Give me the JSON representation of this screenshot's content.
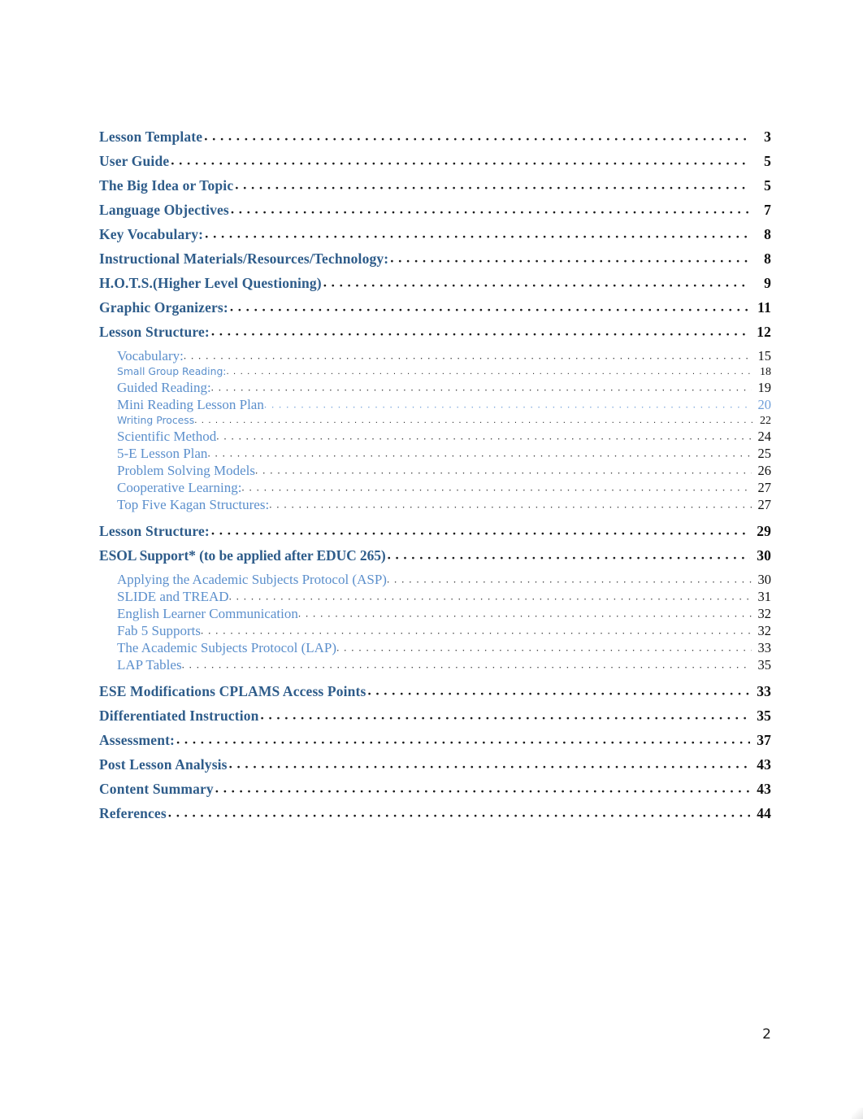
{
  "document": {
    "footer_page_number": "2",
    "colors": {
      "heading_blue": "#2e5c8a",
      "subheading_blue": "#5b8fcc",
      "leader_dark": "#2b2b2b",
      "leader_blue": "#6f9ed8",
      "page_number_dark": "#0d0d0d"
    }
  },
  "toc": {
    "entries": [
      {
        "level": 1,
        "label": "Lesson  Template",
        "page": "3"
      },
      {
        "level": 1,
        "label": "User Guide",
        "page": "5"
      },
      {
        "level": 1,
        "label": "The Big Idea or Topic",
        "page": "5"
      },
      {
        "level": 1,
        "label": "Language Objectives",
        "page": "7"
      },
      {
        "level": 1,
        "label": "Key  Vocabulary:",
        "page": "8"
      },
      {
        "level": 1,
        "label": "Instructional  Materials/Resources/Technology:",
        "page": "8"
      },
      {
        "level": 1,
        "label": "H.O.T.S.(Higher Level Questioning)",
        "page": "9"
      },
      {
        "level": 1,
        "label": "Graphic  Organizers:",
        "page": "11"
      },
      {
        "level": 1,
        "label": "Lesson  Structure:",
        "page": "12"
      },
      {
        "level": 2,
        "label": "Vocabulary:",
        "page": "15"
      },
      {
        "level": 3,
        "label": "Small Group Reading:",
        "page": "18"
      },
      {
        "level": 2,
        "label": "Guided Reading:",
        "page": "19"
      },
      {
        "level": 2,
        "label": "Mini Reading Lesson Plan",
        "page": "20",
        "style": "blue-leader"
      },
      {
        "level": 3,
        "label": "Writing Process",
        "page": "22"
      },
      {
        "level": 2,
        "label": "Scientific Method",
        "page": "24"
      },
      {
        "level": 2,
        "label": "5-E Lesson Plan",
        "page": "25"
      },
      {
        "level": 2,
        "label": "Problem Solving Models",
        "page": "26"
      },
      {
        "level": 2,
        "label": "Cooperative Learning:",
        "page": "27"
      },
      {
        "level": 2,
        "label": "Top Five Kagan Structures:",
        "page": "27"
      },
      {
        "level": 1,
        "label": "Lesson  Structure:",
        "page": "29"
      },
      {
        "level": 1,
        "label": "ESOL Support* (to be applied after EDUC 265)",
        "page": "30"
      },
      {
        "level": 2,
        "label": "Applying the Academic Subjects Protocol (ASP)",
        "page": "30"
      },
      {
        "level": 2,
        "label": "SLIDE and TREAD",
        "page": "31"
      },
      {
        "level": 2,
        "label": "English Learner Communication",
        "page": "32"
      },
      {
        "level": 2,
        "label": "Fab 5 Supports",
        "page": "32"
      },
      {
        "level": 2,
        "label": "The Academic Subjects Protocol (LAP)",
        "page": "33"
      },
      {
        "level": 2,
        "label": "LAP Tables",
        "page": "35"
      },
      {
        "level": 1,
        "label": "ESE Modifications CPLAMS Access Points",
        "page": "33"
      },
      {
        "level": 1,
        "label": "Differentiated  Instruction",
        "page": "35"
      },
      {
        "level": 1,
        "label": "Assessment:",
        "page": "37"
      },
      {
        "level": 1,
        "label": "Post Lesson Analysis",
        "page": "43"
      },
      {
        "level": 1,
        "label": "Content  Summary",
        "page": "43"
      },
      {
        "level": 1,
        "label": "References",
        "page": "44"
      }
    ]
  }
}
